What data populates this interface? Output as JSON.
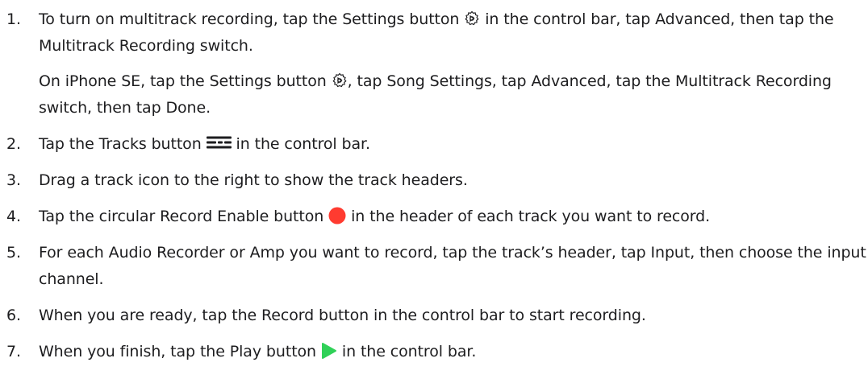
{
  "steps": [
    {
      "number": "1.",
      "text_before": "To turn on multitrack recording, tap the Settings button ",
      "icon": "settings-gear-icon",
      "text_after": " in the control bar, tap Advanced, then tap the Multitrack Recording switch.",
      "note": {
        "text_before": "On iPhone SE, tap the Settings button ",
        "icon": "settings-gear-icon",
        "text_after": ", tap Song Settings, tap Advanced, tap the Multitrack Recording switch, then tap Done."
      }
    },
    {
      "number": "2.",
      "text_before": "Tap the Tracks button ",
      "icon": "tracks-icon",
      "text_after": " in the control bar."
    },
    {
      "number": "3.",
      "text": "Drag a track icon to the right to show the track headers."
    },
    {
      "number": "4.",
      "text_before": "Tap the circular Record Enable button ",
      "icon": "record-enable-icon",
      "text_after": " in the header of each track you want to record."
    },
    {
      "number": "5.",
      "text": "For each Audio Recorder or Amp you want to record, tap the track’s header, tap Input, then choose the input channel."
    },
    {
      "number": "6.",
      "text": "When you are ready, tap the Record button in the control bar to start recording."
    },
    {
      "number": "7.",
      "text_before": "When you finish, tap the Play button ",
      "icon": "play-icon",
      "text_after": " in the control bar."
    }
  ],
  "colors": {
    "text": "#1d1d1f",
    "record": "#ff3b30",
    "play": "#30d158"
  }
}
